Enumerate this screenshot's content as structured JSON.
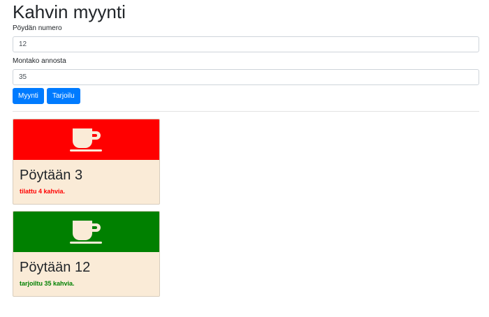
{
  "page": {
    "title": "Kahvin myynti"
  },
  "form": {
    "table_label": "Pöydän numero",
    "table_value": "12",
    "portions_label": "Montako annosta",
    "portions_value": "35",
    "sell_button": "Myynti",
    "serve_button": "Tarjoilu"
  },
  "colors": {
    "accent": "#007bff",
    "ordered": "#ff0000",
    "served": "#008000",
    "card_body": "#faebd7",
    "cup": "#faebd7"
  },
  "cards": [
    {
      "title": "Pöytään 3",
      "text": "tilattu 4 kahvia.",
      "status": "ordered",
      "icon": "coffee-cup-icon"
    },
    {
      "title": "Pöytään 12",
      "text": "tarjoiltu 35 kahvia.",
      "status": "served",
      "icon": "coffee-cup-icon"
    }
  ]
}
